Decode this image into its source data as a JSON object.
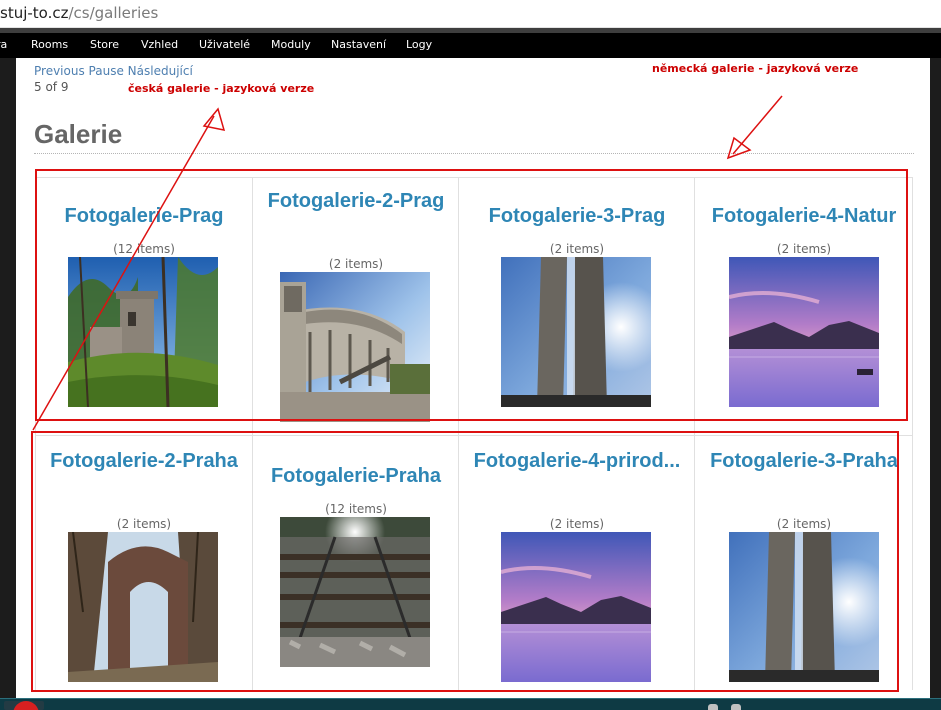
{
  "browser": {
    "url_host": "stuj-to.cz",
    "url_path": "/cs/galleries"
  },
  "toolbar": {
    "items": [
      "ra",
      "Rooms",
      "Store",
      "Vzhled",
      "Uživatelé",
      "Moduly",
      "Nastavení",
      "Logy"
    ]
  },
  "slideshow": {
    "previous_label": "Previous",
    "pause_label": "Pause",
    "next_label": "Následující",
    "counter": "5 of 9"
  },
  "annotations": {
    "czech_note": "česká galerie - jazyková verze",
    "german_note": "německá galerie - jazyková verze",
    "color": "#dd1111"
  },
  "page": {
    "title": "Galerie"
  },
  "galleries": [
    {
      "title": "Fotogalerie-Prag",
      "count": "(12 items)",
      "image": "castle-ruin-photo"
    },
    {
      "title": "Fotogalerie-2-Prag",
      "count": "(2 items)",
      "image": "stadium-photo"
    },
    {
      "title": "Fotogalerie-3-Prag",
      "count": "(2 items)",
      "image": "tower-photo"
    },
    {
      "title": "Fotogalerie-4-Natur",
      "count": "(2 items)",
      "image": "lake-photo"
    },
    {
      "title": "Fotogalerie-2-Praha",
      "count": "(2 items)",
      "image": "ruin-arch-photo"
    },
    {
      "title": "Fotogalerie-Praha",
      "count": "(12 items)",
      "image": "railway-photo"
    },
    {
      "title": "Fotogalerie-4-prirod...",
      "count": "(2 items)",
      "image": "lake-photo"
    },
    {
      "title": "Fotogalerie-3-Praha",
      "count": "(2 items)",
      "image": "tower-photo"
    }
  ],
  "colors": {
    "link": "#2e86b5",
    "toolbar_bg": "#000000",
    "annotation": "#cc0000"
  }
}
